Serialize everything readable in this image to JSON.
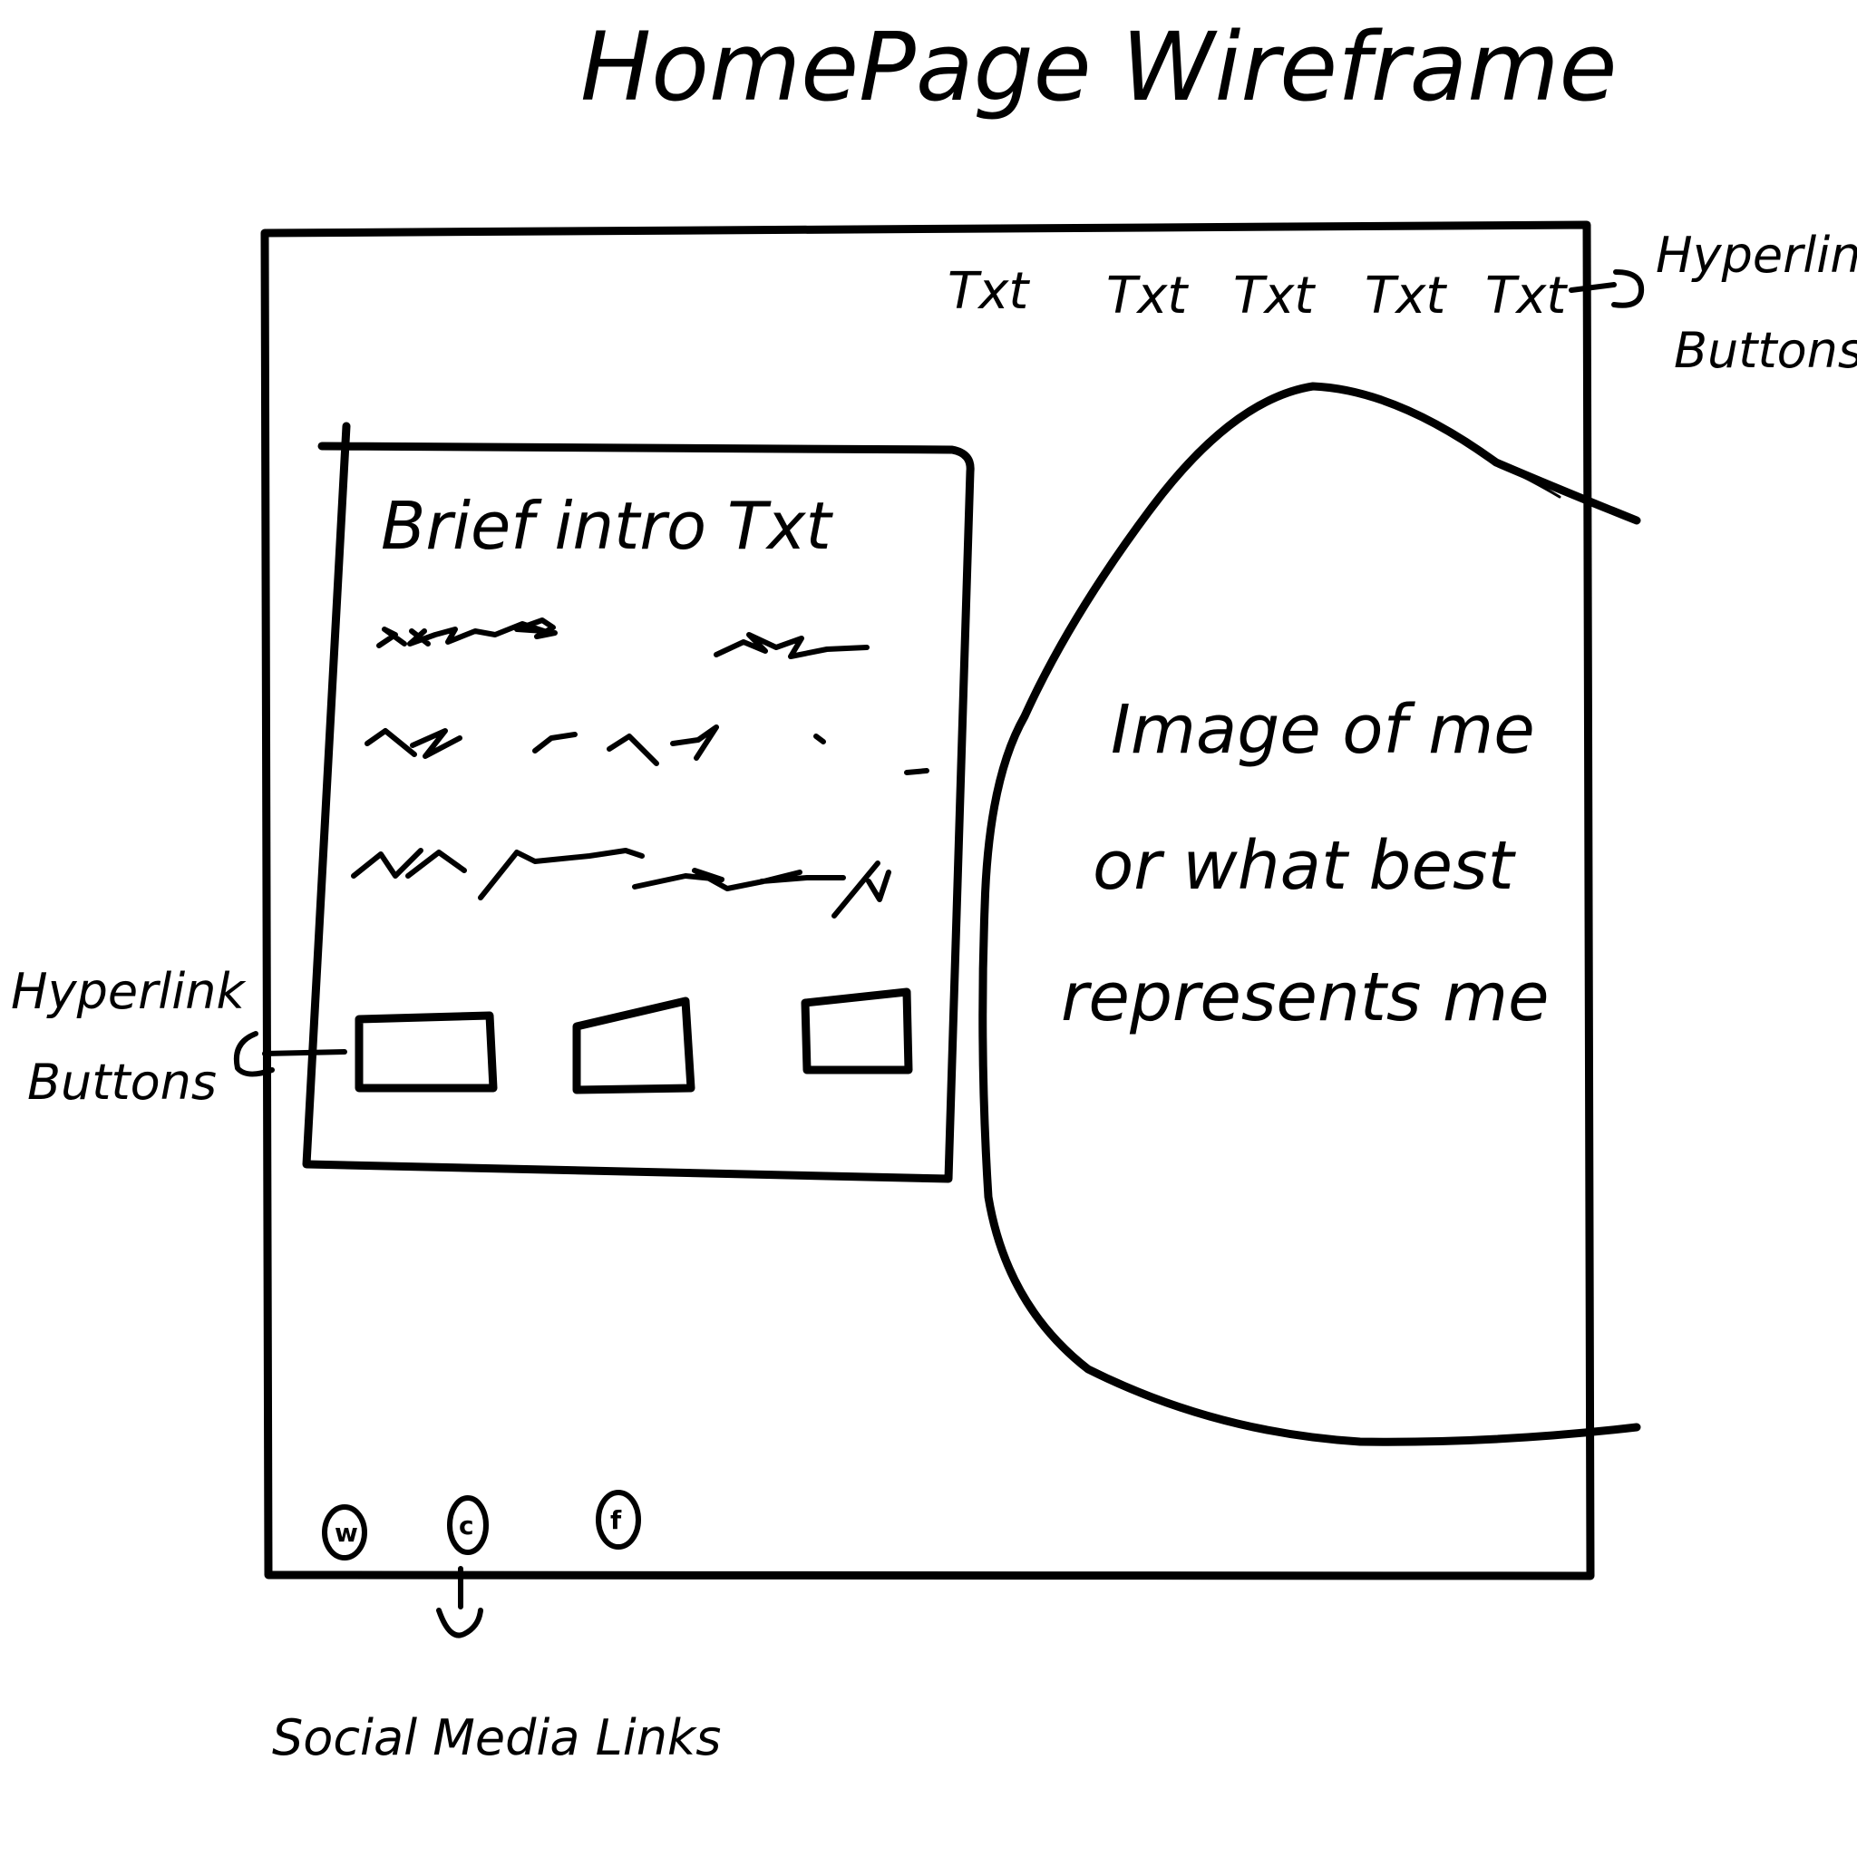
{
  "title": "HomePage Wireframe",
  "nav": {
    "items": [
      "Txt",
      "Txt",
      "Txt",
      "Txt",
      "Txt"
    ],
    "annotation_line1": "Hyperlink",
    "annotation_line2": "Buttons"
  },
  "intro": {
    "heading": "Brief intro Txt",
    "left_annotation_line1": "Hyperlink",
    "left_annotation_line2": "Buttons"
  },
  "image_area": {
    "line1": "Image of me",
    "line2": "or what best",
    "line3": "represents me"
  },
  "social": {
    "icons": [
      "w",
      "c",
      "f"
    ],
    "icon_names": [
      "whatsapp-icon",
      "contact-icon",
      "facebook-icon"
    ],
    "annotation": "Social Media Links"
  }
}
